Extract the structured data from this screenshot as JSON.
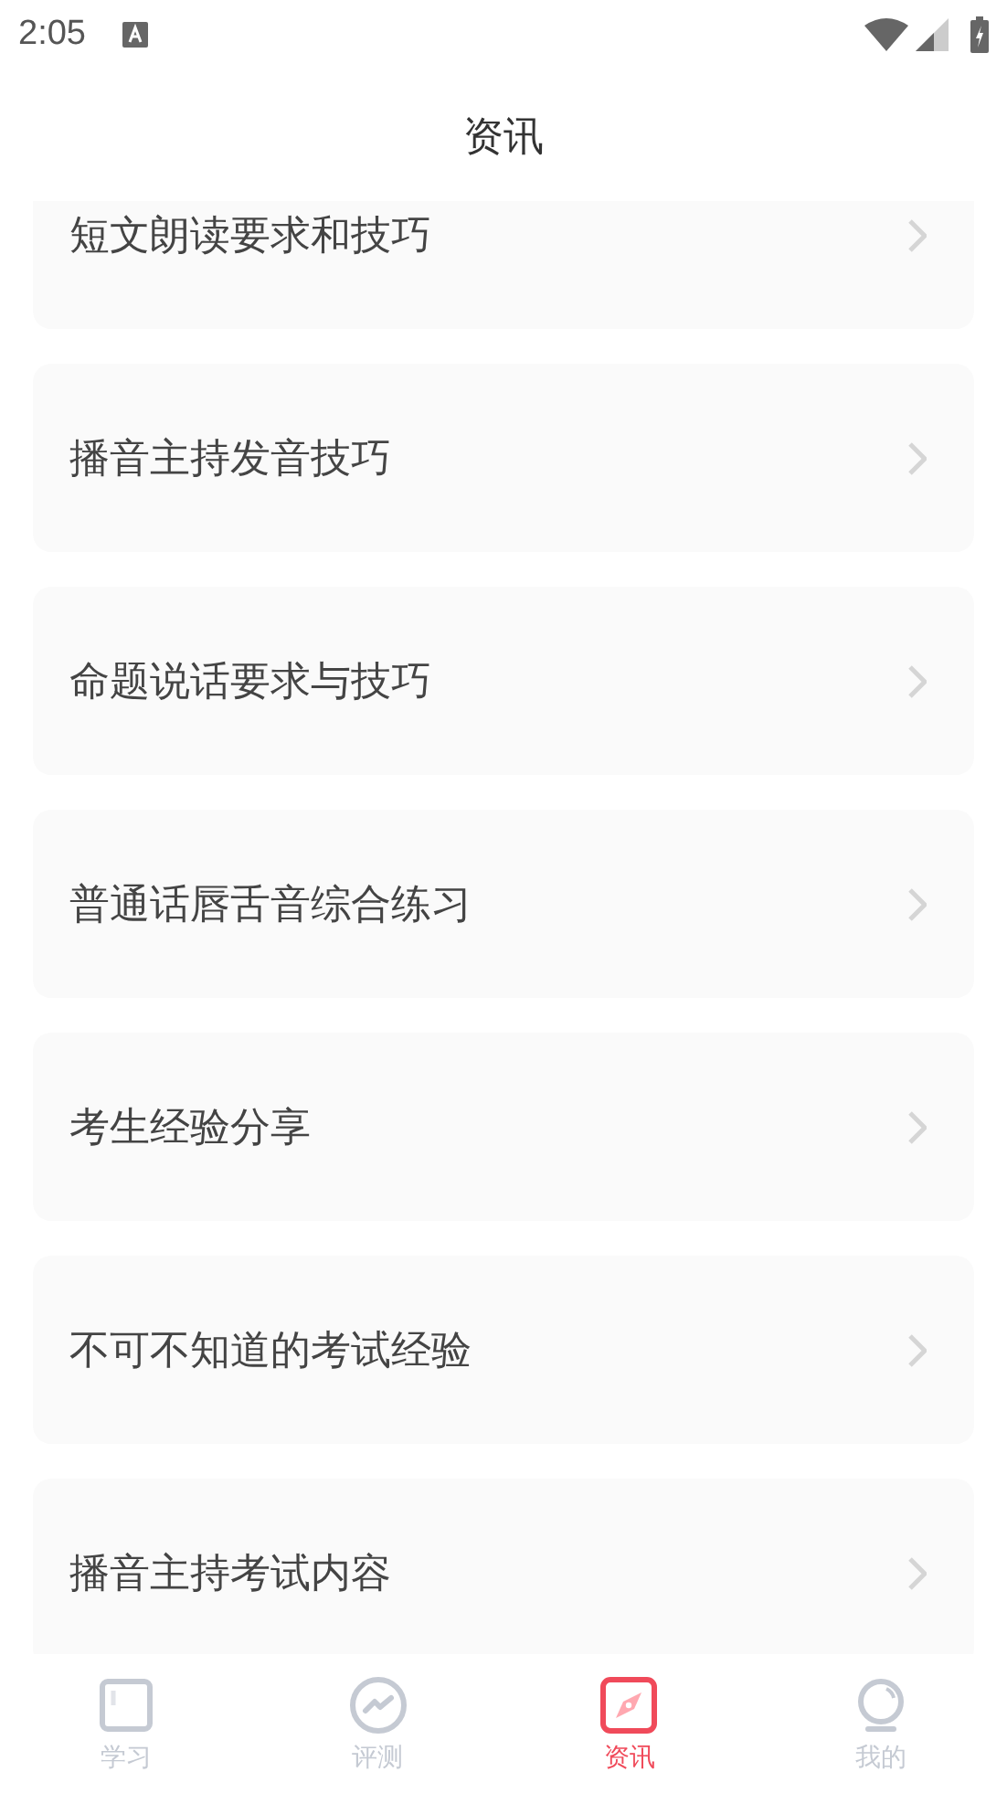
{
  "status_bar": {
    "time": "2:05"
  },
  "title": "资讯",
  "articles": [
    {
      "title": "短文朗读要求和技巧"
    },
    {
      "title": "播音主持发音技巧"
    },
    {
      "title": "命题说话要求与技巧"
    },
    {
      "title": "普通话唇舌音综合练习"
    },
    {
      "title": "考生经验分享"
    },
    {
      "title": "不可不知道的考试经验"
    },
    {
      "title": "播音主持考试内容"
    }
  ],
  "tabs": [
    {
      "label": "学习",
      "kind": "study",
      "selected": false
    },
    {
      "label": "评测",
      "kind": "test",
      "selected": false
    },
    {
      "label": "资讯",
      "kind": "news",
      "selected": true
    },
    {
      "label": "我的",
      "kind": "profile",
      "selected": false
    }
  ]
}
